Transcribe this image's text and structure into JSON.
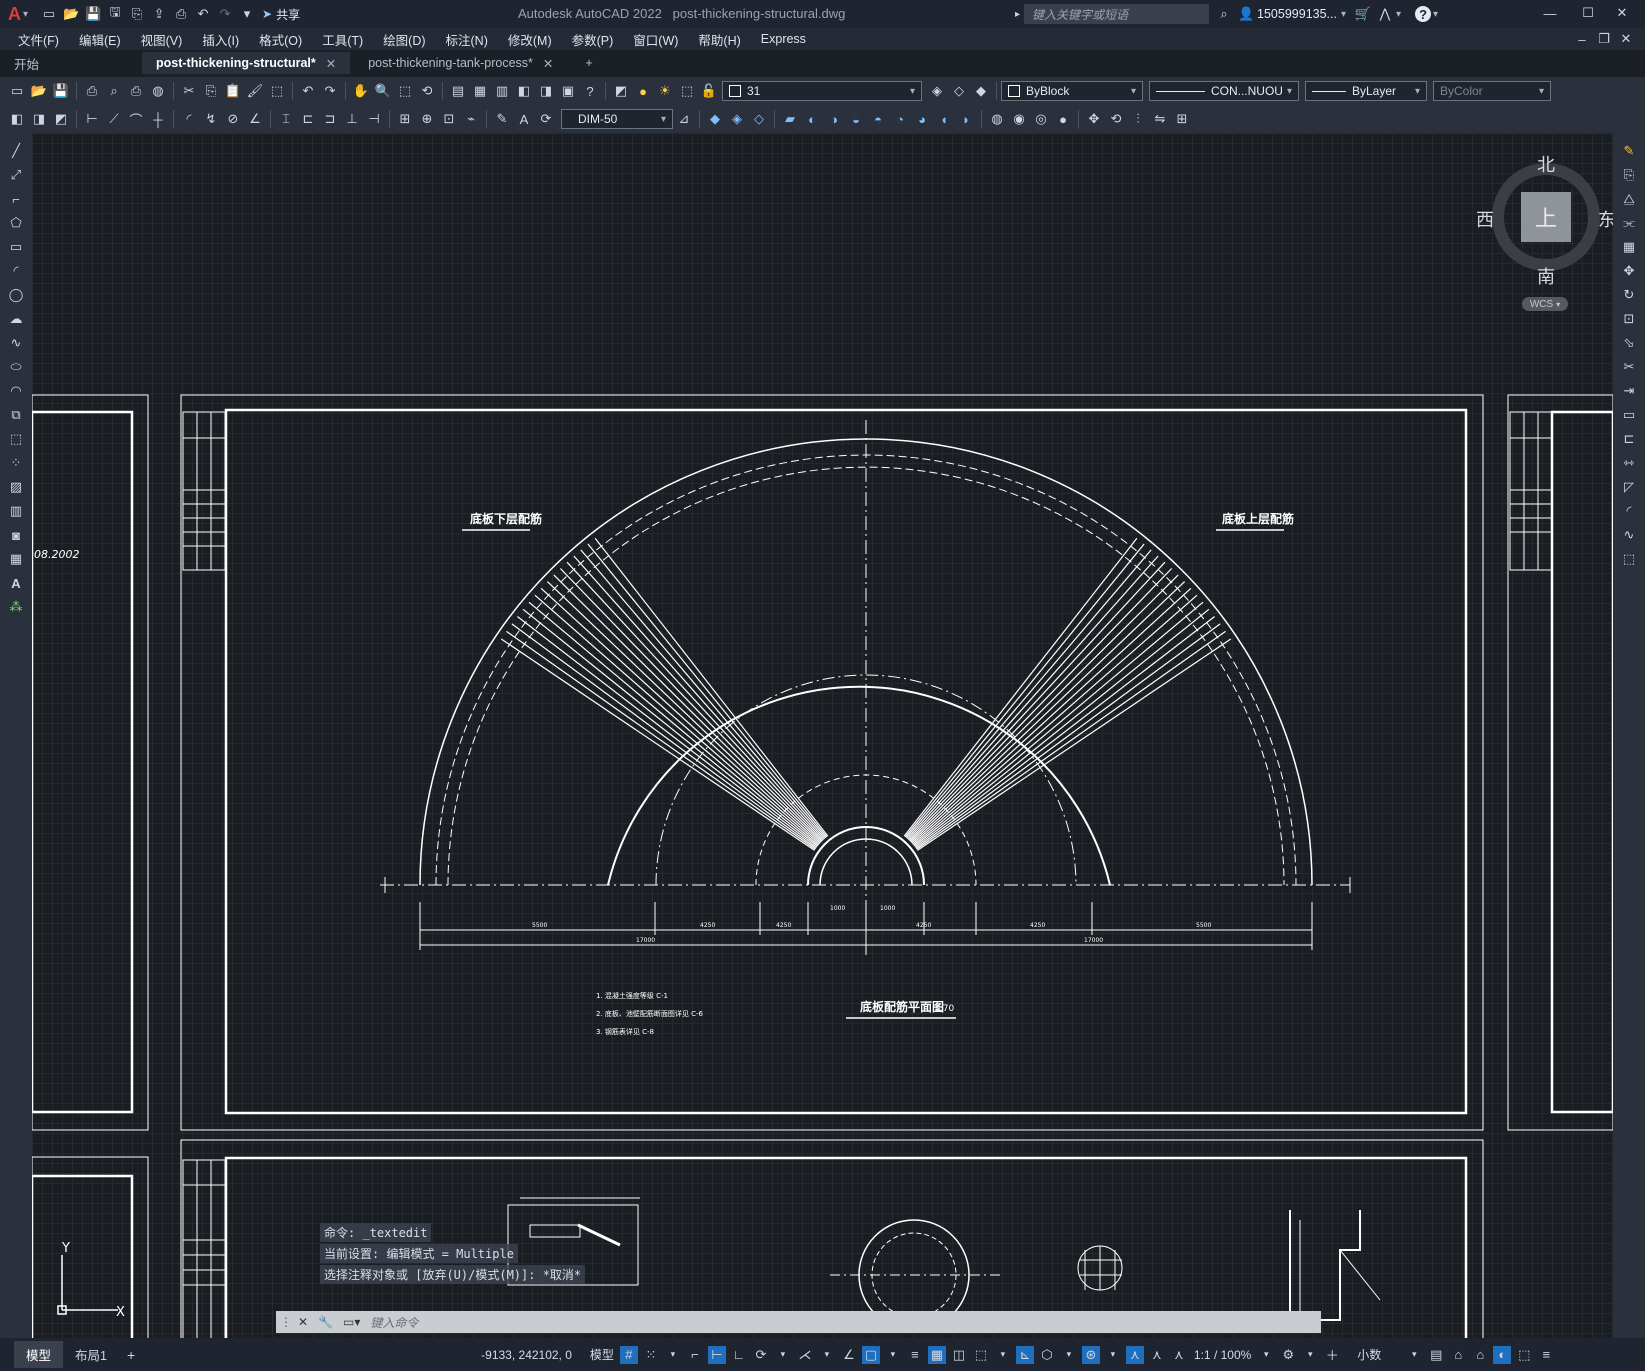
{
  "app": {
    "title": "Autodesk AutoCAD 2022",
    "file_name": "post-thickening-structural.dwg",
    "share_label": "共享",
    "search_placeholder": "键入关键字或短语",
    "user": "1505999135..."
  },
  "menu": [
    "文件(F)",
    "编辑(E)",
    "视图(V)",
    "插入(I)",
    "格式(O)",
    "工具(T)",
    "绘图(D)",
    "标注(N)",
    "修改(M)",
    "参数(P)",
    "窗口(W)",
    "帮助(H)",
    "Express"
  ],
  "tabs": [
    {
      "label": "开始",
      "active": false,
      "closable": false
    },
    {
      "label": "post-thickening-structural*",
      "active": true,
      "closable": true
    },
    {
      "label": "post-thickening-tank-process*",
      "active": false,
      "closable": true
    }
  ],
  "toolbar": {
    "layer_name": "31",
    "color": "ByBlock",
    "linetype": "CON...NUOU",
    "lineweight": "ByLayer",
    "plotstyle": "ByColor",
    "dim_style": "DIM-50"
  },
  "viewcube": {
    "north": "北",
    "south": "南",
    "east": "东",
    "west": "西",
    "face": "上",
    "wcs": "WCS"
  },
  "drawing": {
    "label_lower_rebar": "底板下层配筋",
    "label_upper_rebar": "底板上层配筋",
    "plan_title": "底板配筋平面图",
    "plan_scale": "1:70",
    "left_code": "08.2002",
    "notes": [
      "1. 混凝土强度等级 C-1",
      "2. 底板、池壁配筋断面图详见 C-6",
      "3. 钢筋表详见 C-8"
    ],
    "dimensions_top": [
      "5500",
      "4250",
      "4250",
      "1000",
      "1000",
      "4250",
      "4250",
      "5500"
    ],
    "dimensions_bottom": [
      "17000",
      "17000"
    ]
  },
  "command": {
    "history": [
      "命令: _textedit",
      "当前设置: 编辑模式 = Multiple",
      "选择注释对象或 [放弃(U)/模式(M)]: *取消*"
    ],
    "placeholder": "键入命令"
  },
  "status": {
    "layout_tabs": [
      "模型",
      "布局1"
    ],
    "coords": "-9133, 242102, 0",
    "space": "模型",
    "scale": "1:1 / 100%",
    "units": "小数"
  }
}
